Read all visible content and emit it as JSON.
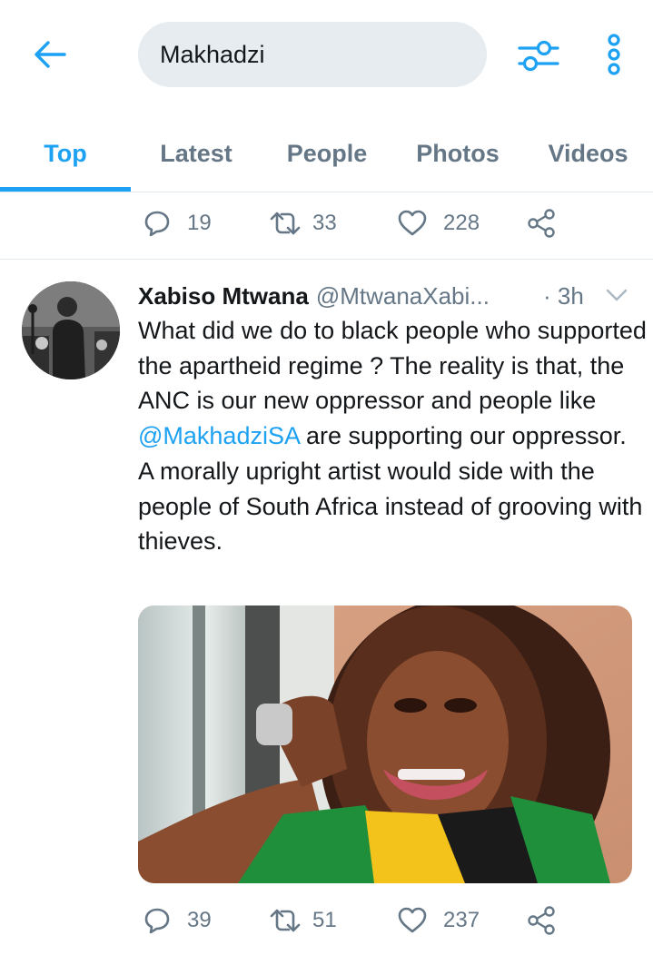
{
  "search": {
    "query": "Makhadzi"
  },
  "tabs": [
    {
      "label": "Top",
      "active": true
    },
    {
      "label": "Latest",
      "active": false
    },
    {
      "label": "People",
      "active": false
    },
    {
      "label": "Photos",
      "active": false
    },
    {
      "label": "Videos",
      "active": false
    }
  ],
  "previous_tweet": {
    "replies": "19",
    "retweets": "33",
    "likes": "228"
  },
  "tweet": {
    "display_name": "Xabiso Mtwana",
    "handle": "@MtwanaXabi...",
    "time": "· 3h",
    "text_before_mention": "What did we do to black people who supported the apartheid regime ? The reality is that, the ANC is our new oppressor and people like ",
    "mention": "@MakhadziSA",
    "text_after_mention": " are supporting our oppressor. A morally upright artist would side with the people of South Africa instead of grooving with thieves.",
    "replies": "39",
    "retweets": "51",
    "likes": "237"
  },
  "icons": {
    "back": "back-arrow-icon",
    "filter": "filter-sliders-icon",
    "more": "more-vertical-icon",
    "reply": "reply-icon",
    "retweet": "retweet-icon",
    "like": "heart-icon",
    "share": "share-icon",
    "caret": "chevron-down-icon"
  },
  "colors": {
    "accent": "#1da1f2",
    "secondary_text": "#657786",
    "search_bg": "#e6ecf0",
    "divider": "#e1e8ed"
  }
}
